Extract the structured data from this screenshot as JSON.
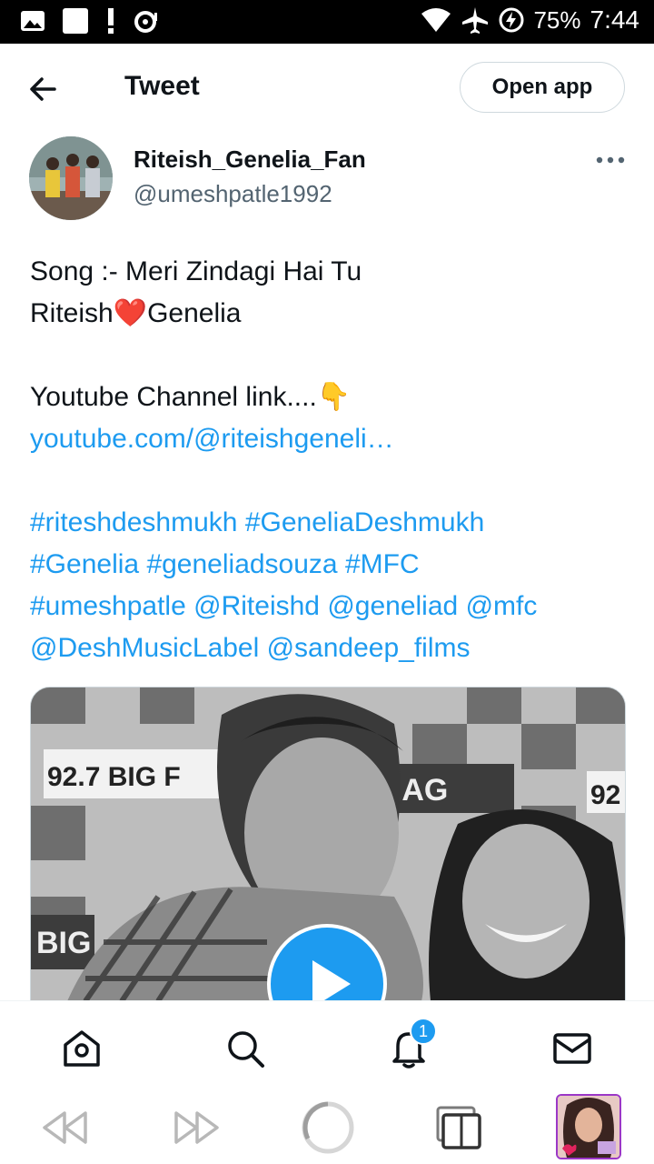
{
  "status_bar": {
    "battery": "75%",
    "time": "7:44"
  },
  "header": {
    "title": "Tweet",
    "open_app_label": "Open app"
  },
  "author": {
    "name": "Riteish_Genelia_Fan",
    "handle": "@umeshpatle1992"
  },
  "tweet": {
    "line1": "Song :- Meri Zindagi Hai Tu",
    "line2_a": "Riteish",
    "line2_emoji": "❤️",
    "line2_b": "Genelia",
    "line3": "Youtube Channel link....",
    "line3_emoji": "👇",
    "link": "youtube.com/@riteishgeneli…",
    "tags": {
      "t1": "#riteshdeshmukh",
      "t2": "#GeneliaDeshmukh",
      "t3": "#Genelia",
      "t4": "#geneliadsouza",
      "t5": "#MFC",
      "t6": "#umeshpatle",
      "m1": "@Riteishd",
      "m2": "@geneliad",
      "m3": "@mfc",
      "m4": "@DeshMusicLabel",
      "m5": "@sandeep_films"
    }
  },
  "media": {
    "banner_left": "92.7 BIG F",
    "banner_right": "MAG",
    "banner_far": "92",
    "banner_bottom": "BIG"
  },
  "bottom_nav": {
    "notification_count": "1"
  },
  "icons": {
    "back": "arrow-left-icon",
    "more": "more-horizontal-icon",
    "home": "home-icon",
    "search": "search-icon",
    "notifications": "bell-icon",
    "messages": "mail-icon",
    "play": "play-icon"
  },
  "colors": {
    "accent": "#1d9bf0",
    "text": "#0f1419",
    "secondary": "#536471"
  }
}
